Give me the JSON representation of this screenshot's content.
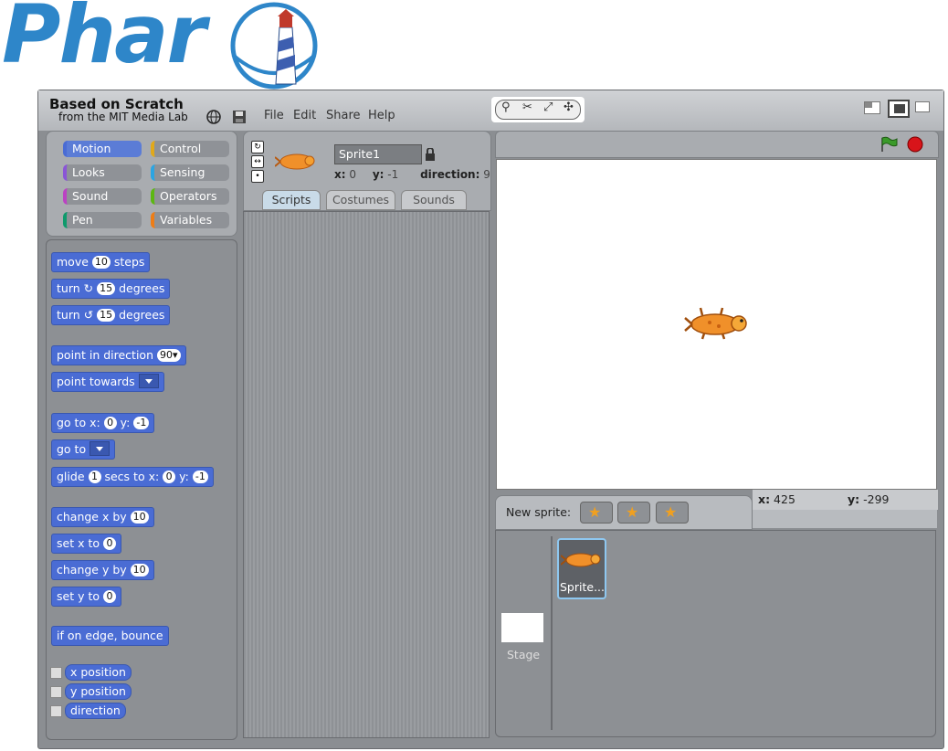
{
  "logo": {
    "text": "Phar"
  },
  "header": {
    "title": "Based on Scratch",
    "subtitle": "from the MIT Media Lab",
    "menu": [
      "File",
      "Edit",
      "Share",
      "Help"
    ]
  },
  "categories": [
    {
      "label": "Motion",
      "color": "#4a6cd4",
      "selected": true
    },
    {
      "label": "Control",
      "color": "#e1a91a"
    },
    {
      "label": "Looks",
      "color": "#8a55d7"
    },
    {
      "label": "Sensing",
      "color": "#2ca5e2"
    },
    {
      "label": "Sound",
      "color": "#bb42c3"
    },
    {
      "label": "Operators",
      "color": "#5cb712"
    },
    {
      "label": "Pen",
      "color": "#0e9a6c"
    },
    {
      "label": "Variables",
      "color": "#ee7d16"
    }
  ],
  "blocks": {
    "move": {
      "pre": "move",
      "val": "10",
      "post": "steps"
    },
    "turn_cw": {
      "pre": "turn",
      "val": "15",
      "post": "degrees"
    },
    "turn_ccw": {
      "pre": "turn",
      "val": "15",
      "post": "degrees"
    },
    "point_dir": {
      "pre": "point in direction",
      "val": "90"
    },
    "point_towards": {
      "pre": "point towards"
    },
    "goto_xy": {
      "pre": "go to x:",
      "x": "0",
      "mid": "y:",
      "y": "-1"
    },
    "goto": {
      "pre": "go to"
    },
    "glide": {
      "pre": "glide",
      "secs": "1",
      "mid1": "secs to x:",
      "x": "0",
      "mid2": "y:",
      "y": "-1"
    },
    "change_x": {
      "pre": "change x by",
      "val": "10"
    },
    "set_x": {
      "pre": "set x to",
      "val": "0"
    },
    "change_y": {
      "pre": "change y by",
      "val": "10"
    },
    "set_y": {
      "pre": "set y to",
      "val": "0"
    },
    "bounce": {
      "pre": "if on edge, bounce"
    },
    "reporters": [
      "x position",
      "y position",
      "direction"
    ]
  },
  "sprite": {
    "name": "Sprite1",
    "x_label": "x:",
    "x": "0",
    "y_label": "y:",
    "y": "-1",
    "dir_label": "direction:",
    "dir": "9"
  },
  "tabs": [
    "Scripts",
    "Costumes",
    "Sounds"
  ],
  "readout": {
    "x_label": "x:",
    "x": "425",
    "y_label": "y:",
    "y": "-299"
  },
  "new_sprite_label": "New sprite:",
  "corral": {
    "sprite_label": "Sprite...",
    "stage_label": "Stage"
  },
  "colors": {
    "motion": "#4a6cd4",
    "stage_bg": "#ffffff",
    "accent": "#5b7cd6"
  }
}
